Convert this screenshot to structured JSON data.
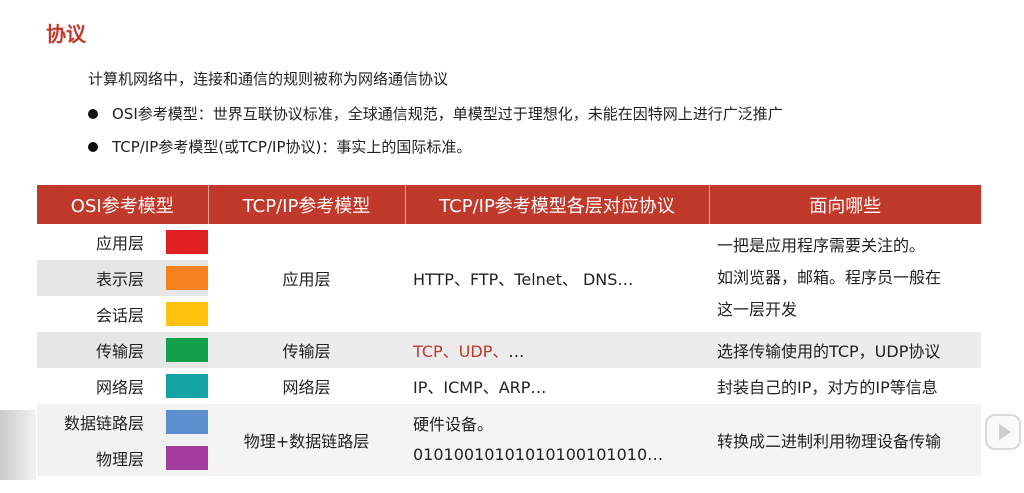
{
  "title": "协议",
  "intro": "计算机网络中，连接和通信的规则被称为网络通信协议",
  "bullets": [
    "OSI参考模型：世界互联协议标准，全球通信规范，单模型过于理想化，未能在因特网上进行广泛推广",
    "TCP/IP参考模型(或TCP/IP协议)：事实上的国际标准。"
  ],
  "table": {
    "headers": [
      "OSI参考模型",
      "TCP/IP参考模型",
      "TCP/IP参考模型各层对应协议",
      "面向哪些"
    ],
    "osi_layers": [
      {
        "name": "应用层",
        "color": "#e02020"
      },
      {
        "name": "表示层",
        "color": "#f5821f"
      },
      {
        "name": "会话层",
        "color": "#ffc20e"
      },
      {
        "name": "传输层",
        "color": "#12a04a"
      },
      {
        "name": "网络层",
        "color": "#14a3a3"
      },
      {
        "name": "数据链路层",
        "color": "#5b8fd0"
      },
      {
        "name": "物理层",
        "color": "#a23c9e"
      }
    ],
    "tcpip_layers": [
      "应用层",
      "传输层",
      "网络层",
      "物理+数据链路层"
    ],
    "protocols": {
      "app": "HTTP、FTP、Telnet、 DNS…",
      "transport_red": "TCP、UDP、",
      "transport_rest": "…",
      "network": "IP、ICMP、ARP…",
      "link_line1": "硬件设备。",
      "link_line2": "01010010101010100101010…"
    },
    "descriptions": {
      "app_line1": "一把是应用程序需要关注的。",
      "app_line2": "如浏览器，邮箱。程序员一般在",
      "app_line3": "这一层开发",
      "transport": "选择传输使用的TCP，UDP协议",
      "network": "封装自己的IP，对方的IP等信息",
      "link": "转换成二进制利用物理设备传输"
    }
  }
}
